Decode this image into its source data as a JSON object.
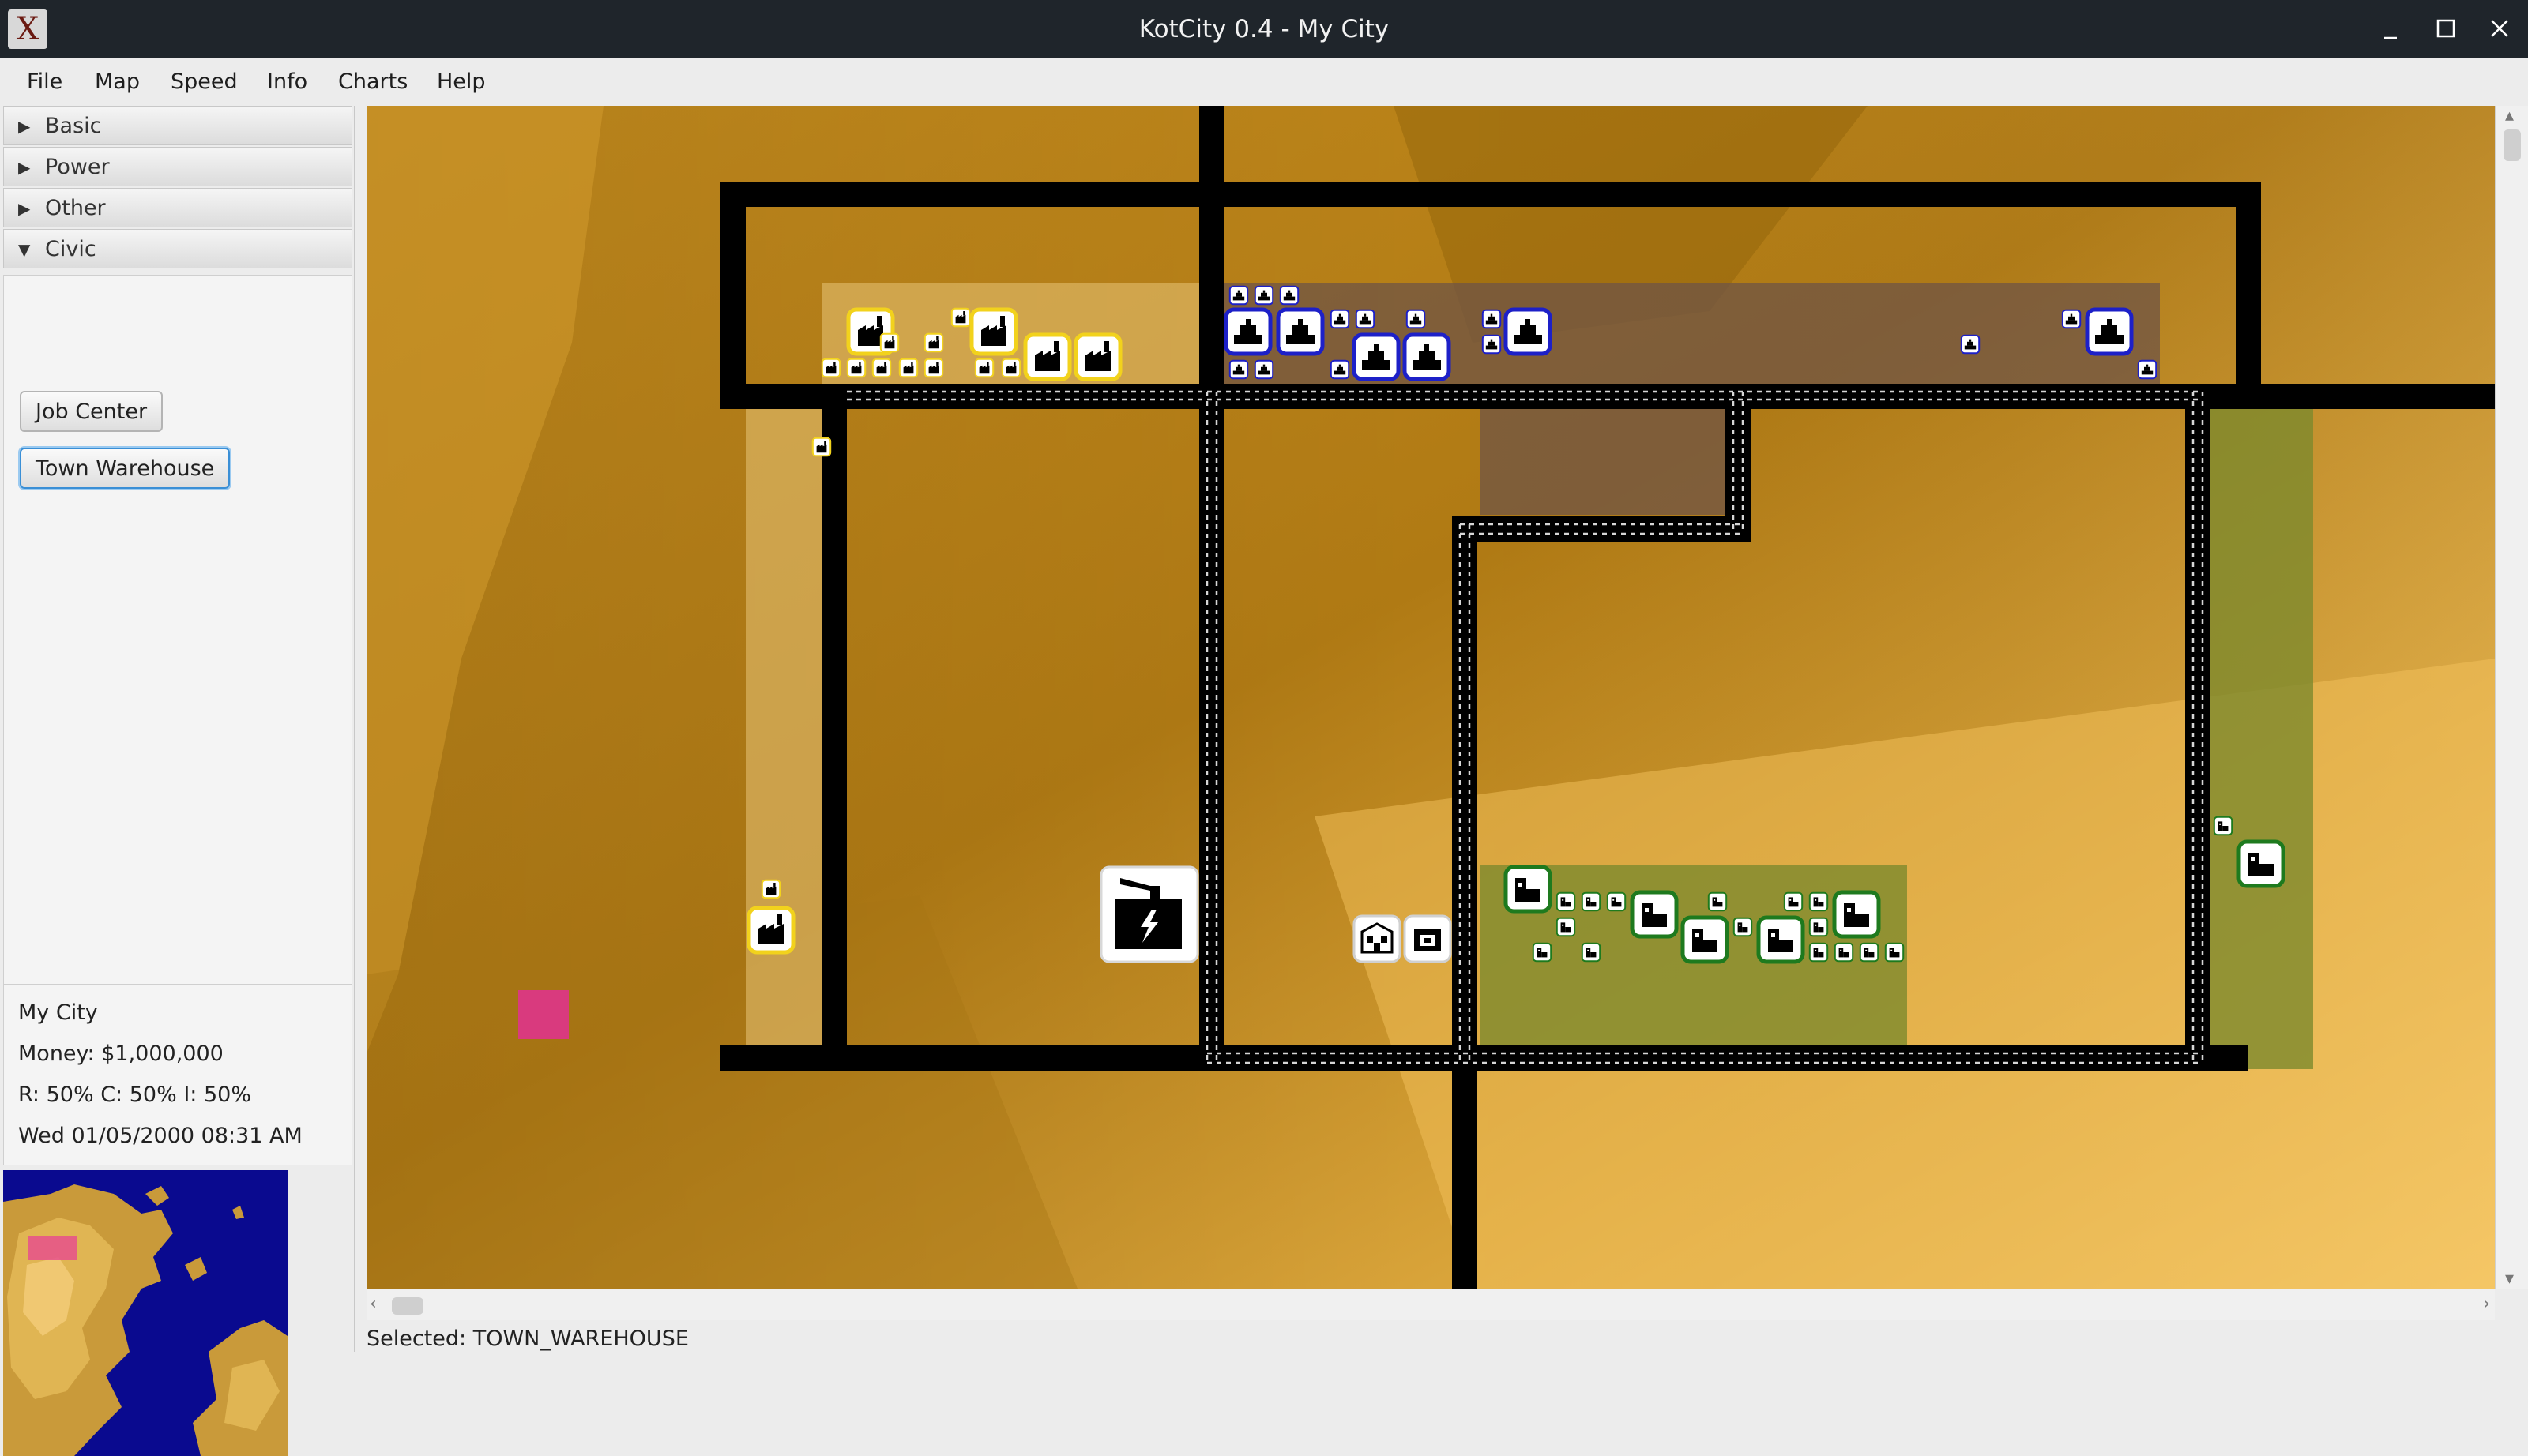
{
  "window": {
    "title": "KotCity 0.4 - My City",
    "app_icon_glyph": "X"
  },
  "menu": [
    "File",
    "Map",
    "Speed",
    "Info",
    "Charts",
    "Help"
  ],
  "sidebar": {
    "sections": [
      {
        "label": "Basic",
        "expanded": false
      },
      {
        "label": "Power",
        "expanded": false
      },
      {
        "label": "Other",
        "expanded": false
      },
      {
        "label": "Civic",
        "expanded": true
      }
    ],
    "civic_tools": [
      {
        "label": "Job Center",
        "selected": false
      },
      {
        "label": "Town Warehouse",
        "selected": true
      }
    ]
  },
  "city_info": {
    "name": "My City",
    "money": "Money: $1,000,000",
    "demand": "R: 50% C: 50% I: 50%",
    "datetime": "Wed 01/05/2000 08:31 AM"
  },
  "status": {
    "selected": "Selected: TOWN_WAREHOUSE"
  },
  "colors": {
    "titlebar": "#1f252b",
    "terrain_light": "#f2c263",
    "terrain_dark": "#a46e10",
    "road": "#000000",
    "industrial_zone": "#e8c479",
    "commercial_zone": "#6f5446",
    "residential_zone": "#7d8a2d",
    "industrial_border": "#f2d21c",
    "commercial_border": "#1d20c8",
    "residential_border": "#1e7a1e",
    "power_line": "#d6d6d6",
    "marker": "#d93a7e",
    "water": "#0a0a8f"
  },
  "icons": {
    "industrial": "factory-icon",
    "commercial": "shop-icon",
    "residential": "house-icon",
    "power_plant": "power-plant-icon",
    "warehouse": "warehouse-icon",
    "job_center": "job-center-icon"
  }
}
